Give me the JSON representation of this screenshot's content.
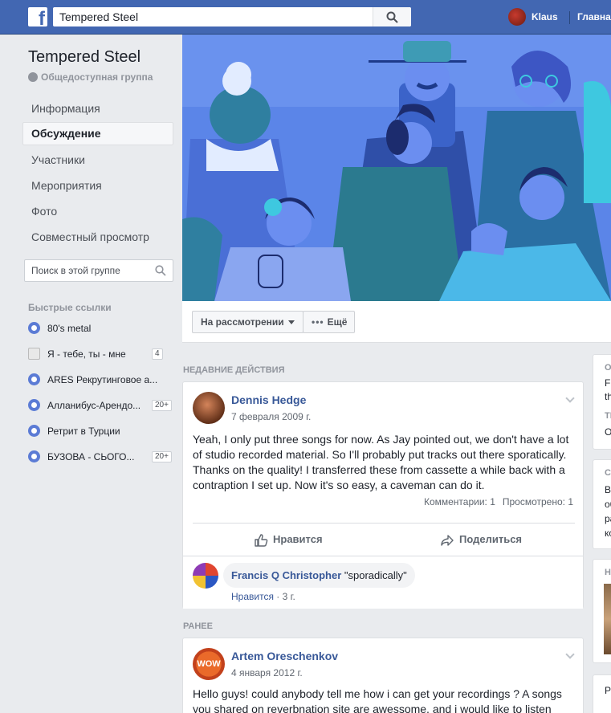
{
  "topbar": {
    "logo_letter": "f",
    "search_value": "Tempered Steel",
    "user_name": "Klaus",
    "home_label": "Главна"
  },
  "group": {
    "name": "Tempered Steel",
    "type": "Общедоступная группа"
  },
  "nav": [
    {
      "label": "Информация",
      "active": false
    },
    {
      "label": "Обсуждение",
      "active": true
    },
    {
      "label": "Участники",
      "active": false
    },
    {
      "label": "Мероприятия",
      "active": false
    },
    {
      "label": "Фото",
      "active": false
    },
    {
      "label": "Совместный просмотр",
      "active": false
    }
  ],
  "group_search": {
    "placeholder": "Поиск в этой группе"
  },
  "quick_links": {
    "title": "Быстрые ссылки",
    "items": [
      {
        "label": "80's metal",
        "badge": ""
      },
      {
        "label": "Я - тебе, ты - мне",
        "badge": "4"
      },
      {
        "label": "ARES Рекрутинговое а...",
        "badge": ""
      },
      {
        "label": "Алланибус-Арендо...",
        "badge": "20+"
      },
      {
        "label": "Ретрит в Турции",
        "badge": ""
      },
      {
        "label": "БУЗОВА - СЬОГО...",
        "badge": "20+"
      }
    ]
  },
  "actions": {
    "review_label": "На рассмотрении",
    "more_label": "Ещё"
  },
  "feed": {
    "recent_label": "Недавние действия",
    "earlier_label": "Ранее",
    "post1": {
      "author": "Dennis Hedge",
      "date": "7 февраля 2009 г.",
      "text": "Yeah, I only put three songs for now. As Jay pointed out, we don't have a lot of studio recorded material. So I'll probably put tracks out there sporatically. Thanks on the quality! I transferred these from cassette a while back with a contraption I set up. Now it's so easy, a caveman can do it.",
      "comments_stat": "Комментарии: 1",
      "views_stat": "Просмотрено: 1",
      "like_label": "Нравится",
      "share_label": "Поделиться",
      "comment": {
        "author": "Francis Q Christopher",
        "text": "\"sporadically\"",
        "like_label": "Нравится",
        "time": "3 г."
      }
    },
    "post2": {
      "author": "Artem Oreschenkov",
      "date": "4 января 2012 г.",
      "avatar_text": "WOW",
      "text": "Hello guys! could anybody tell me how i can get your recordings ? A songs you shared on reverbnation site are awessome, and i would like to listen"
    }
  },
  "right_peek": {
    "c1a": "О",
    "c1b": "F",
    "c1c": "th",
    "c1d": "ТИ",
    "c1e": "О",
    "c2a": "СО",
    "c2b": "В",
    "c2c": "об",
    "c2d": "ра",
    "c2e": "ко",
    "c3a": "НІ",
    "c4a": "Ре"
  },
  "colors": {
    "brand": "#4267b2",
    "link": "#385898",
    "cover_bg": "#5b85e8"
  }
}
